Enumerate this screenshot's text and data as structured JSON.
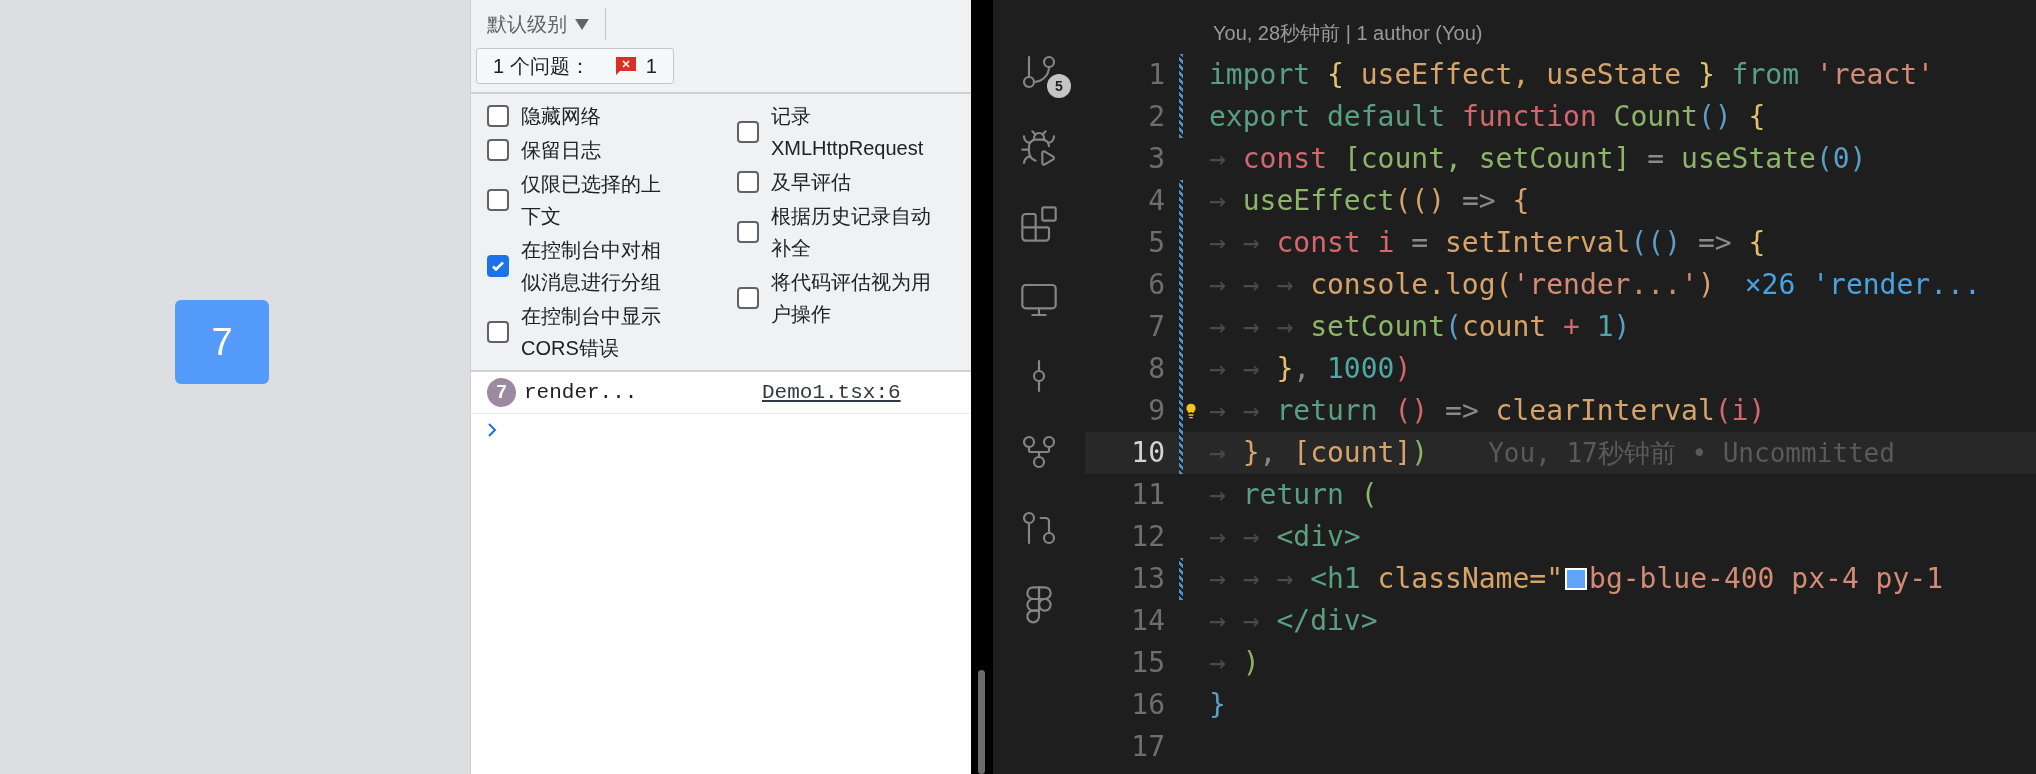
{
  "page": {
    "counter": "7"
  },
  "devtools": {
    "level_filter": "默认级别",
    "issues": {
      "label": "1 个问题：",
      "count": "1"
    },
    "settings": [
      [
        {
          "label": "隐藏网络",
          "checked": false
        },
        {
          "label": "保留日志",
          "checked": false
        },
        {
          "label": "仅限已选择的上下文",
          "checked": false
        },
        {
          "label": "在控制台中对相似消息进行分组",
          "checked": true
        },
        {
          "label": "在控制台中显示CORS错误",
          "checked": false
        }
      ],
      [
        {
          "label": "记录XMLHttpRequest",
          "checked": false
        },
        {
          "label": "及早评估",
          "checked": false
        },
        {
          "label": "根据历史记录自动补全",
          "checked": false
        },
        {
          "label": "将代码评估视为用户操作",
          "checked": false
        }
      ]
    ],
    "messages": [
      {
        "repeat": "7",
        "text": "render...",
        "source": "Demo1.tsx:6"
      }
    ]
  },
  "editor": {
    "source_control_badge": "5",
    "blame_header": "You, 28秒钟前 | 1 author (You)",
    "lines": [
      {
        "number": "1",
        "changed": true,
        "current": false,
        "lightbulb": false,
        "tokens": [
          {
            "kind": "kw",
            "text": "import "
          },
          {
            "kind": "brace",
            "text": "{ "
          },
          {
            "kind": "var",
            "text": "useEffect, useState "
          },
          {
            "kind": "brace",
            "text": "} "
          },
          {
            "kind": "kw",
            "text": "from "
          },
          {
            "kind": "str",
            "text": "'react'"
          }
        ]
      },
      {
        "number": "2",
        "changed": true,
        "current": false,
        "lightbulb": false,
        "tokens": [
          {
            "kind": "kw",
            "text": "export default "
          },
          {
            "kind": "storage",
            "text": "function "
          },
          {
            "kind": "fn",
            "text": "Count"
          },
          {
            "kind": "paren",
            "text": "() "
          },
          {
            "kind": "brace",
            "text": "{"
          }
        ]
      },
      {
        "number": "3",
        "changed": false,
        "current": false,
        "lightbulb": false,
        "tokens": [
          {
            "kind": "tab",
            "text": "→ "
          },
          {
            "kind": "storage",
            "text": "const "
          },
          {
            "kind": "fn",
            "text": "[count, setCount] "
          },
          {
            "kind": "op",
            "text": "= "
          },
          {
            "kind": "fn",
            "text": "useState"
          },
          {
            "kind": "paren",
            "text": "(0)"
          }
        ]
      },
      {
        "number": "4",
        "changed": true,
        "current": false,
        "lightbulb": false,
        "tokens": [
          {
            "kind": "tab",
            "text": "→ "
          },
          {
            "kind": "fn",
            "text": "useEffect"
          },
          {
            "kind": "var",
            "text": "(() "
          },
          {
            "kind": "op",
            "text": "=> "
          },
          {
            "kind": "var",
            "text": "{"
          }
        ]
      },
      {
        "number": "5",
        "changed": true,
        "current": false,
        "lightbulb": false,
        "tokens": [
          {
            "kind": "tab",
            "text": "→ → "
          },
          {
            "kind": "storage",
            "text": "const i "
          },
          {
            "kind": "op",
            "text": "= "
          },
          {
            "kind": "var",
            "text": "setInterval"
          },
          {
            "kind": "paren",
            "text": "(() "
          },
          {
            "kind": "op",
            "text": "=> "
          },
          {
            "kind": "brace",
            "text": "{"
          }
        ]
      },
      {
        "number": "6",
        "changed": true,
        "current": false,
        "lightbulb": false,
        "tokens": [
          {
            "kind": "tab",
            "text": "→ → → "
          },
          {
            "kind": "var",
            "text": "console.log("
          },
          {
            "kind": "str",
            "text": "'render...'"
          },
          {
            "kind": "var",
            "text": ")"
          }
        ],
        "annotation": {
          "kind": "log",
          "text": "×26 'render..."
        }
      },
      {
        "number": "7",
        "changed": true,
        "current": false,
        "lightbulb": false,
        "tokens": [
          {
            "kind": "tab",
            "text": "→ → → "
          },
          {
            "kind": "fn",
            "text": "setCount"
          },
          {
            "kind": "paren",
            "text": "("
          },
          {
            "kind": "var",
            "text": "count "
          },
          {
            "kind": "storage",
            "text": "+ "
          },
          {
            "kind": "num",
            "text": "1"
          },
          {
            "kind": "paren",
            "text": ")"
          }
        ]
      },
      {
        "number": "8",
        "changed": true,
        "current": false,
        "lightbulb": false,
        "tokens": [
          {
            "kind": "tab",
            "text": "→ → "
          },
          {
            "kind": "brace",
            "text": "}"
          },
          {
            "kind": "op",
            "text": ", "
          },
          {
            "kind": "num",
            "text": "1000"
          },
          {
            "kind": "storage",
            "text": ")"
          }
        ]
      },
      {
        "number": "9",
        "changed": true,
        "current": false,
        "lightbulb": true,
        "tokens": [
          {
            "kind": "tab",
            "text": "→ → "
          },
          {
            "kind": "kw",
            "text": "return "
          },
          {
            "kind": "storage",
            "text": "() "
          },
          {
            "kind": "op",
            "text": "=> "
          },
          {
            "kind": "var",
            "text": "clearInterval"
          },
          {
            "kind": "storage",
            "text": "(i)"
          }
        ]
      },
      {
        "number": "10",
        "changed": true,
        "current": true,
        "lightbulb": false,
        "tokens": [
          {
            "kind": "tab",
            "text": "→ "
          },
          {
            "kind": "var",
            "text": "}"
          },
          {
            "kind": "op",
            "text": ", "
          },
          {
            "kind": "var",
            "text": "[count]"
          },
          {
            "kind": "fn",
            "text": ")"
          }
        ],
        "annotation": {
          "kind": "blame",
          "text": "You, 17秒钟前 • Uncommitted"
        }
      },
      {
        "number": "11",
        "changed": false,
        "current": false,
        "lightbulb": false,
        "tokens": [
          {
            "kind": "tab",
            "text": "→ "
          },
          {
            "kind": "kw",
            "text": "return "
          },
          {
            "kind": "fn",
            "text": "("
          }
        ]
      },
      {
        "number": "12",
        "changed": false,
        "current": false,
        "lightbulb": false,
        "tokens": [
          {
            "kind": "tab",
            "text": "→ → "
          },
          {
            "kind": "tag",
            "text": "<div>"
          }
        ]
      },
      {
        "number": "13",
        "changed": true,
        "current": false,
        "lightbulb": false,
        "tokens": [
          {
            "kind": "tab",
            "text": "→ → → "
          },
          {
            "kind": "tag",
            "text": "<h1 "
          },
          {
            "kind": "var",
            "text": "className=\""
          },
          {
            "kind": "swatch",
            "color": "#60a5fa"
          },
          {
            "kind": "str",
            "text": "bg-blue-400 px-4 py-1"
          }
        ]
      },
      {
        "number": "14",
        "changed": false,
        "current": false,
        "lightbulb": false,
        "tokens": [
          {
            "kind": "tab",
            "text": "→ → "
          },
          {
            "kind": "tag",
            "text": "</div>"
          }
        ]
      },
      {
        "number": "15",
        "changed": false,
        "current": false,
        "lightbulb": false,
        "tokens": [
          {
            "kind": "tab",
            "text": "→ "
          },
          {
            "kind": "fn",
            "text": ")"
          }
        ]
      },
      {
        "number": "16",
        "changed": false,
        "current": false,
        "lightbulb": false,
        "tokens": [
          {
            "kind": "paren",
            "text": "}"
          }
        ]
      },
      {
        "number": "17",
        "changed": false,
        "current": false,
        "lightbulb": false
      }
    ]
  }
}
